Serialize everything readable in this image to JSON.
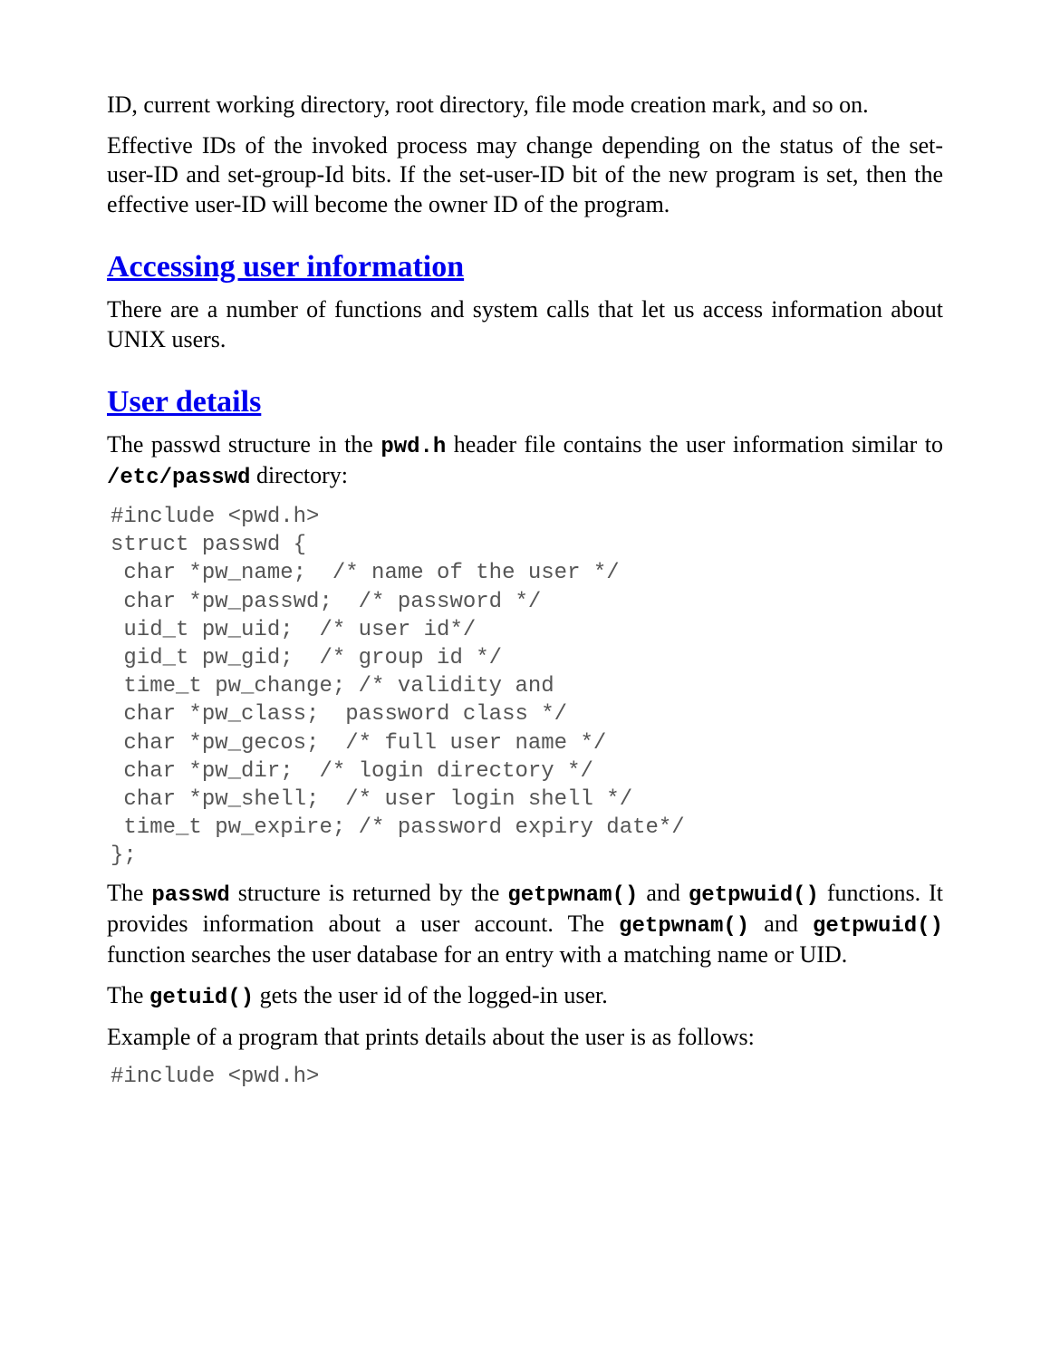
{
  "paragraphs": {
    "p1": "ID, current working directory, root directory, file mode creation mark, and so on.",
    "p2": "Effective IDs of the invoked process may change depending on the status of the set-user-ID and set-group-Id bits. If the set-user-ID bit of the new program is set, then the effective user-ID will become the owner ID of the program.",
    "p3": "There are a number of functions and system calls that let us access information about UNIX users.",
    "p4_a": "The passwd structure in the ",
    "p4_code1": "pwd.h",
    "p4_b": " header file contains the user information similar to ",
    "p4_code2": "/etc/passwd",
    "p4_c": " directory:",
    "p5_a": "The ",
    "p5_code1": "passwd",
    "p5_b": " structure is returned by the ",
    "p5_code2": "getpwnam()",
    "p5_c": " and ",
    "p5_code3": "getpwuid()",
    "p5_d": " functions. It provides information about a user account. The ",
    "p5_code4": "getpwnam()",
    "p5_e": " and ",
    "p5_code5": "getpwuid()",
    "p5_f": " function searches the user database for an entry with a matching name or UID.",
    "p6_a": "The ",
    "p6_code1": "getuid()",
    "p6_b": " gets the user id of the logged-in user.",
    "p7": "Example of a program that prints details about the user is as follows:"
  },
  "headings": {
    "h1": "Accessing user information",
    "h2": "User details"
  },
  "code": {
    "block1": "#include <pwd.h>\nstruct passwd {\n char *pw_name;  /* name of the user */\n char *pw_passwd;  /* password */\n uid_t pw_uid;  /* user id*/\n gid_t pw_gid;  /* group id */\n time_t pw_change; /* validity and\n char *pw_class;  password class */\n char *pw_gecos;  /* full user name */\n char *pw_dir;  /* login directory */\n char *pw_shell;  /* user login shell */\n time_t pw_expire; /* password expiry date*/\n};",
    "block2": "#include <pwd.h>"
  }
}
